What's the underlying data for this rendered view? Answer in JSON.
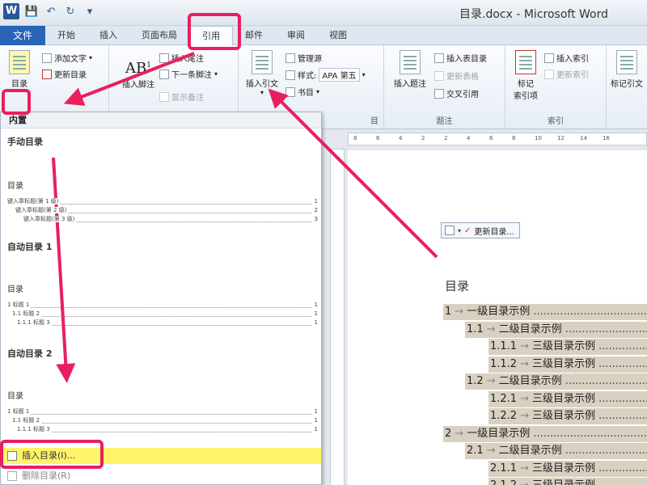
{
  "window": {
    "title": "目录.docx - Microsoft Word",
    "app_icon": "W",
    "qat": [
      "save-icon",
      "undo-icon",
      "redo-icon",
      "customize-icon"
    ]
  },
  "tabs": {
    "file": "文件",
    "items": [
      "开始",
      "插入",
      "页面布局",
      "引用",
      "邮件",
      "审阅",
      "视图"
    ],
    "active_index": 3
  },
  "ribbon": {
    "toc_group": {
      "big_button": "目录",
      "add_text": "添加文字",
      "update_toc": "更新目录"
    },
    "footnotes_group": {
      "insert_footnote": "插入脚注",
      "insert_endnote": "插入尾注",
      "next_footnote": "下一条脚注",
      "show_notes": "显示备注",
      "ab_label": "AB",
      "ab_sup": "1"
    },
    "citations_group": {
      "insert_citation": "插入引文",
      "manage_sources": "管理源",
      "style_label": "样式:",
      "style_value": "APA 第五",
      "bibliography": "书目",
      "title": "目"
    },
    "captions_group": {
      "insert_caption": "插入题注",
      "insert_table_of_figures": "插入表目录",
      "update_table": "更新表格",
      "cross_reference": "交叉引用",
      "title": "题注"
    },
    "index_group": {
      "mark_entry": "标记\n索引项",
      "insert_index": "插入索引",
      "update_index": "更新索引",
      "title": "索引"
    },
    "toa_group": {
      "mark_citation": "标记引文"
    }
  },
  "dropdown": {
    "header": "内置",
    "manual_title": "手动目录",
    "manual_thumb": {
      "title": "目录",
      "lines": [
        {
          "text": "键入章标题(第 1 级)",
          "page": "1"
        },
        {
          "text": "键入章标题(第 2 级)",
          "page": "2"
        },
        {
          "text": "键入章标题(第 3 级)",
          "page": "3"
        }
      ]
    },
    "auto1_title": "自动目录 1",
    "auto1_thumb": {
      "title": "目录",
      "lines": [
        {
          "text": "1    标题 1",
          "page": "1"
        },
        {
          "text": "1.1      标题 2",
          "page": "1"
        },
        {
          "text": "1.1.1     标题 3",
          "page": "1"
        }
      ]
    },
    "auto2_title": "自动目录 2",
    "auto2_thumb": {
      "title": "目录",
      "lines": [
        {
          "text": "1    标题 1",
          "page": "1"
        },
        {
          "text": "1.1          标题 2",
          "page": "1"
        },
        {
          "text": "1.1.1           标题 3",
          "page": "1"
        }
      ]
    },
    "insert_toc": "插入目录(I)...",
    "remove_toc": "删除目录(R)"
  },
  "document": {
    "ruler_ticks": [
      "8",
      "6",
      "4",
      "2",
      "2",
      "4",
      "6",
      "8",
      "10",
      "12",
      "14",
      "16"
    ],
    "field_tab": {
      "update_label": "更新目录..."
    },
    "heading": "目录",
    "entries": [
      {
        "num": "1",
        "text": "一级目录示例",
        "level": 1
      },
      {
        "num": "1.1",
        "text": "二级目录示例",
        "level": 2
      },
      {
        "num": "1.1.1",
        "text": "三级目录示例",
        "level": 3
      },
      {
        "num": "1.1.2",
        "text": "三级目录示例",
        "level": 3
      },
      {
        "num": "1.2",
        "text": "二级目录示例",
        "level": 2
      },
      {
        "num": "1.2.1",
        "text": "三级目录示例",
        "level": 3
      },
      {
        "num": "1.2.2",
        "text": "三级目录示例",
        "level": 3
      },
      {
        "num": "2",
        "text": "一级目录示例",
        "level": 1
      },
      {
        "num": "2.1",
        "text": "二级目录示例",
        "level": 2
      },
      {
        "num": "2.1.1",
        "text": "三级目录示例",
        "level": 3
      },
      {
        "num": "2.1.2",
        "text": "三级目录示例",
        "level": 3
      }
    ]
  },
  "colors": {
    "highlight": "#e8205e",
    "file_tab": "#2a64b8",
    "menu_highlight": "#fff36a",
    "field_shade": "#d9d0c1"
  }
}
